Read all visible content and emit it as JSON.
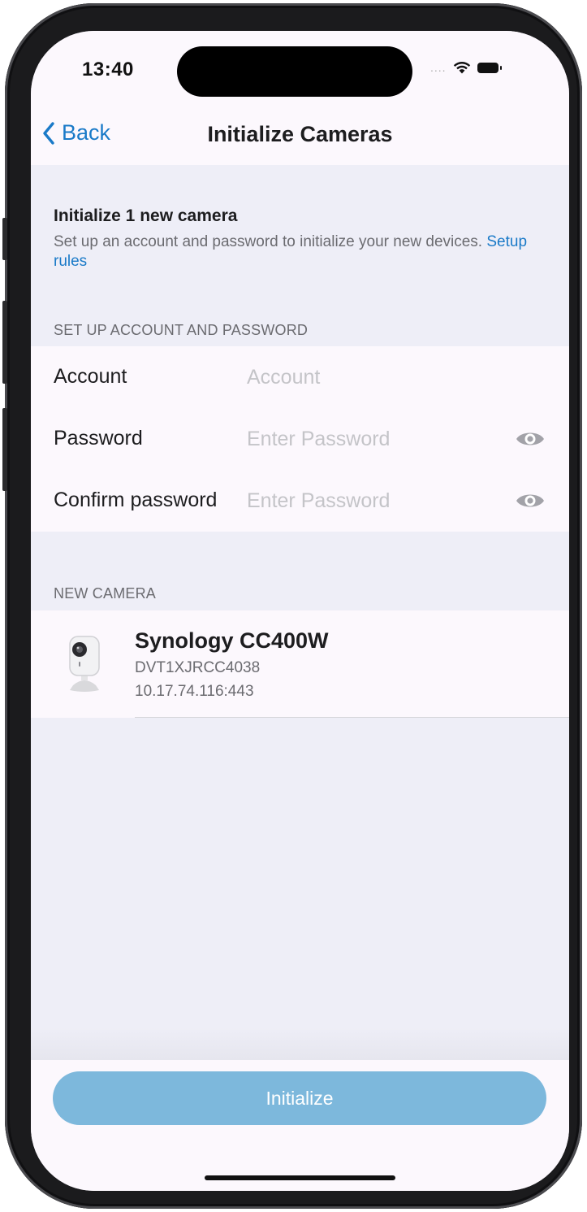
{
  "status_bar": {
    "time": "13:40",
    "signal": "....",
    "icons": [
      "wifi-icon",
      "battery-icon"
    ]
  },
  "nav": {
    "back_label": "Back",
    "title": "Initialize Cameras"
  },
  "intro": {
    "heading": "Initialize 1 new camera",
    "description": "Set up an account and password to initialize your new devices.",
    "link_label": "Setup rules"
  },
  "account_section": {
    "header": "SET UP ACCOUNT AND PASSWORD",
    "fields": [
      {
        "label": "Account",
        "placeholder": "Account",
        "value": ""
      },
      {
        "label": "Password",
        "placeholder": "Enter Password",
        "value": "",
        "icon": "eye-icon"
      },
      {
        "label": "Confirm password",
        "placeholder": "Enter Password",
        "value": "",
        "icon": "eye-icon"
      }
    ]
  },
  "camera_section": {
    "header": "NEW CAMERA",
    "cameras": [
      {
        "name": "Synology CC400W",
        "serial": "DVT1XJRCC4038",
        "address": "10.17.74.116:443",
        "icon": "camera-icon"
      }
    ]
  },
  "footer": {
    "button_label": "Initialize"
  },
  "colors": {
    "accent": "#1a7ac8",
    "button": "#7db8dc",
    "background": "#eeeef7",
    "card": "#fcf8fd",
    "secondary_text": "#6b6b70",
    "placeholder": "#c4c4c8"
  }
}
